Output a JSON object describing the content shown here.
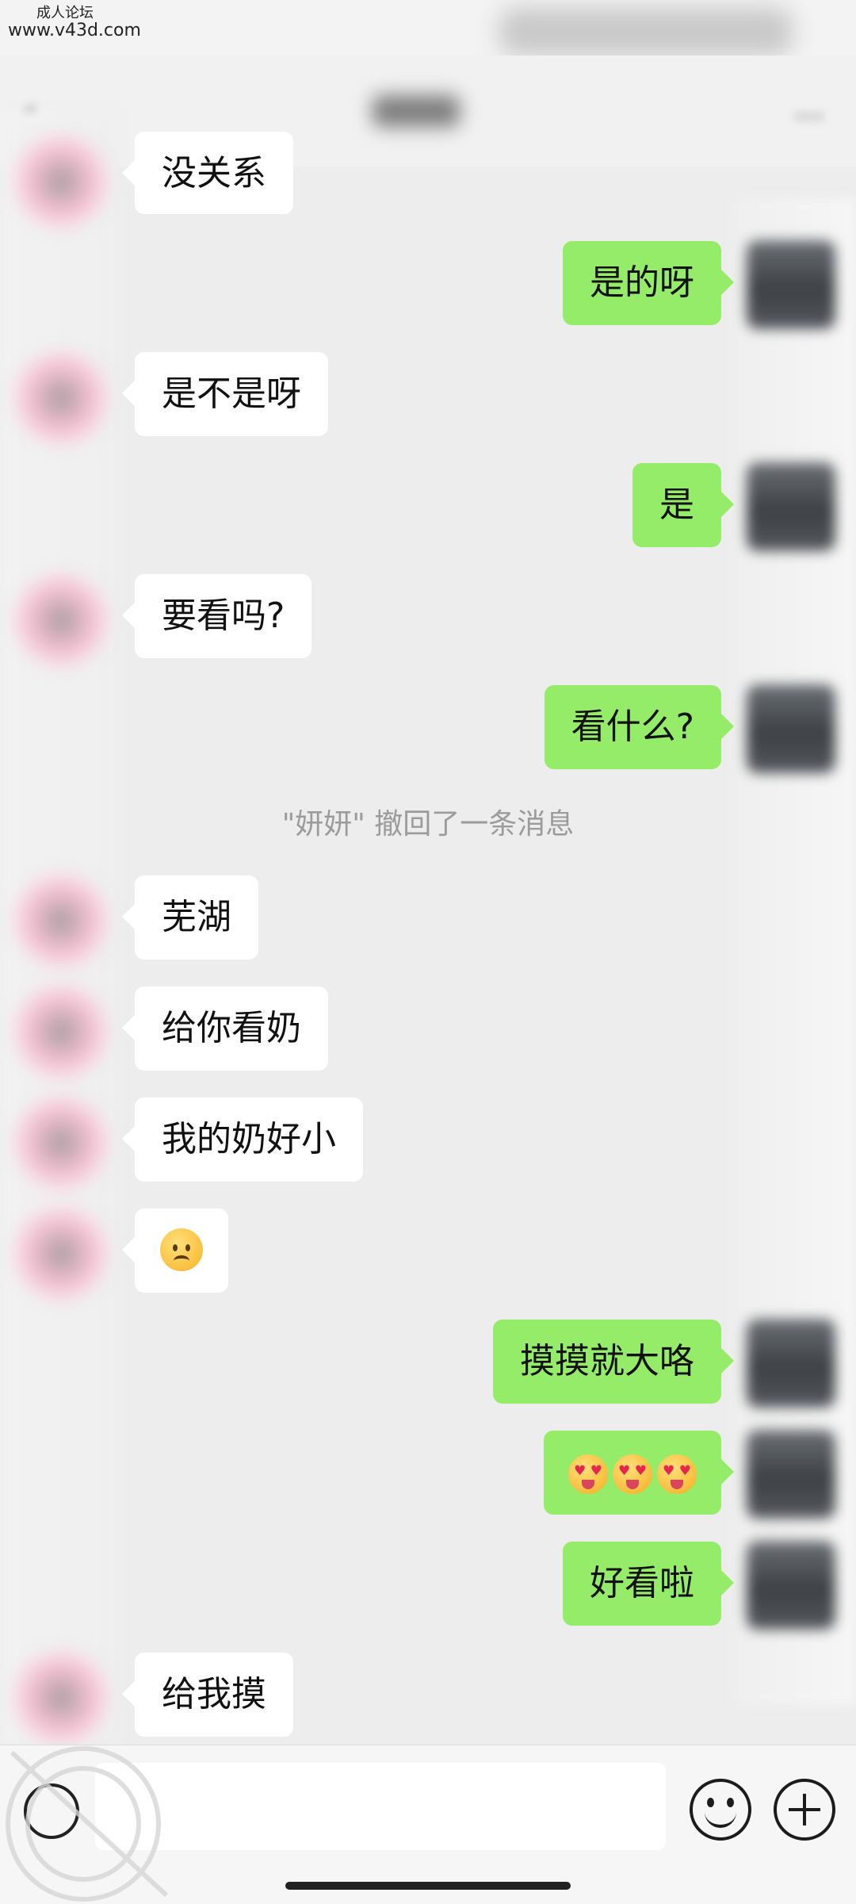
{
  "watermark_top": {
    "line1": "成人论坛",
    "line2": "www.v43d.com"
  },
  "messages": [
    {
      "side": "left",
      "text": "没关系"
    },
    {
      "side": "right",
      "text": "是的呀"
    },
    {
      "side": "left",
      "text": "是不是呀"
    },
    {
      "side": "right",
      "text": "是"
    },
    {
      "side": "left",
      "text": "要看吗?"
    },
    {
      "side": "right",
      "text": "看什么?"
    },
    {
      "side": "left",
      "text": "芜湖"
    },
    {
      "side": "left",
      "text": "给你看奶"
    },
    {
      "side": "left",
      "text": "我的奶好小"
    },
    {
      "side": "left",
      "emoji": "frowning-face"
    },
    {
      "side": "right",
      "text": "摸摸就大咯"
    },
    {
      "side": "right",
      "emoji": "heart-eyes-tongue x3"
    },
    {
      "side": "right",
      "text": "好看啦"
    },
    {
      "side": "left",
      "text": "给我摸"
    }
  ],
  "recall_notice": "\"妍妍\" 撤回了一条消息",
  "icons": {
    "voice": "voice-icon",
    "emoji": "emoji-icon",
    "add": "plus-icon"
  },
  "colors": {
    "right_bubble": "#95ec69",
    "left_bubble": "#ffffff",
    "background": "#ededed"
  }
}
